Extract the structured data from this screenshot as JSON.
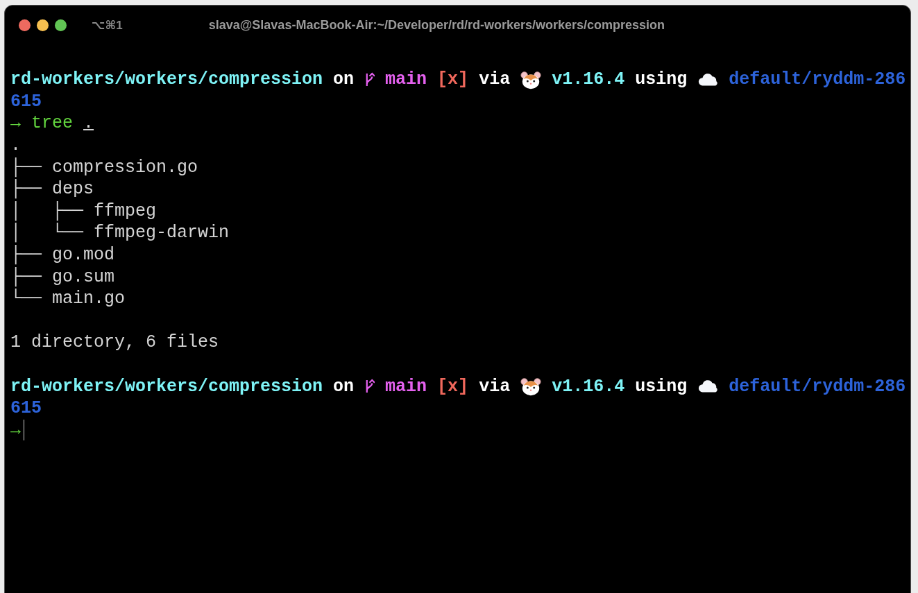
{
  "window": {
    "shortcut": "⌥⌘1",
    "title": "slava@Slavas-MacBook-Air:~/Developer/rd/rd-workers/workers/compression"
  },
  "terminal": {
    "lines": [
      {
        "kind": "prompt",
        "path": "rd-workers/workers/compression",
        "on": "on",
        "branch": "main",
        "git_status": "[x]",
        "via": "via",
        "version": "v1.16.4",
        "using": "using",
        "context": "default/ryddm-286",
        "context_wrap": "615"
      },
      {
        "kind": "command",
        "arrow": "→",
        "command": "tree",
        "argument": "."
      },
      {
        "kind": "output",
        "text": "."
      },
      {
        "kind": "output",
        "text": "├── compression.go"
      },
      {
        "kind": "output",
        "text": "├── deps"
      },
      {
        "kind": "output",
        "text": "│   ├── ffmpeg"
      },
      {
        "kind": "output",
        "text": "│   └── ffmpeg-darwin"
      },
      {
        "kind": "output",
        "text": "├── go.mod"
      },
      {
        "kind": "output",
        "text": "├── go.sum"
      },
      {
        "kind": "output",
        "text": "└── main.go"
      },
      {
        "kind": "blank"
      },
      {
        "kind": "output",
        "text": "1 directory, 6 files"
      },
      {
        "kind": "blank"
      },
      {
        "kind": "prompt",
        "path": "rd-workers/workers/compression",
        "on": "on",
        "branch": "main",
        "git_status": "[x]",
        "via": "via",
        "version": "v1.16.4",
        "using": "using",
        "context": "default/ryddm-286",
        "context_wrap": "615"
      },
      {
        "kind": "input",
        "arrow": "→"
      }
    ]
  }
}
